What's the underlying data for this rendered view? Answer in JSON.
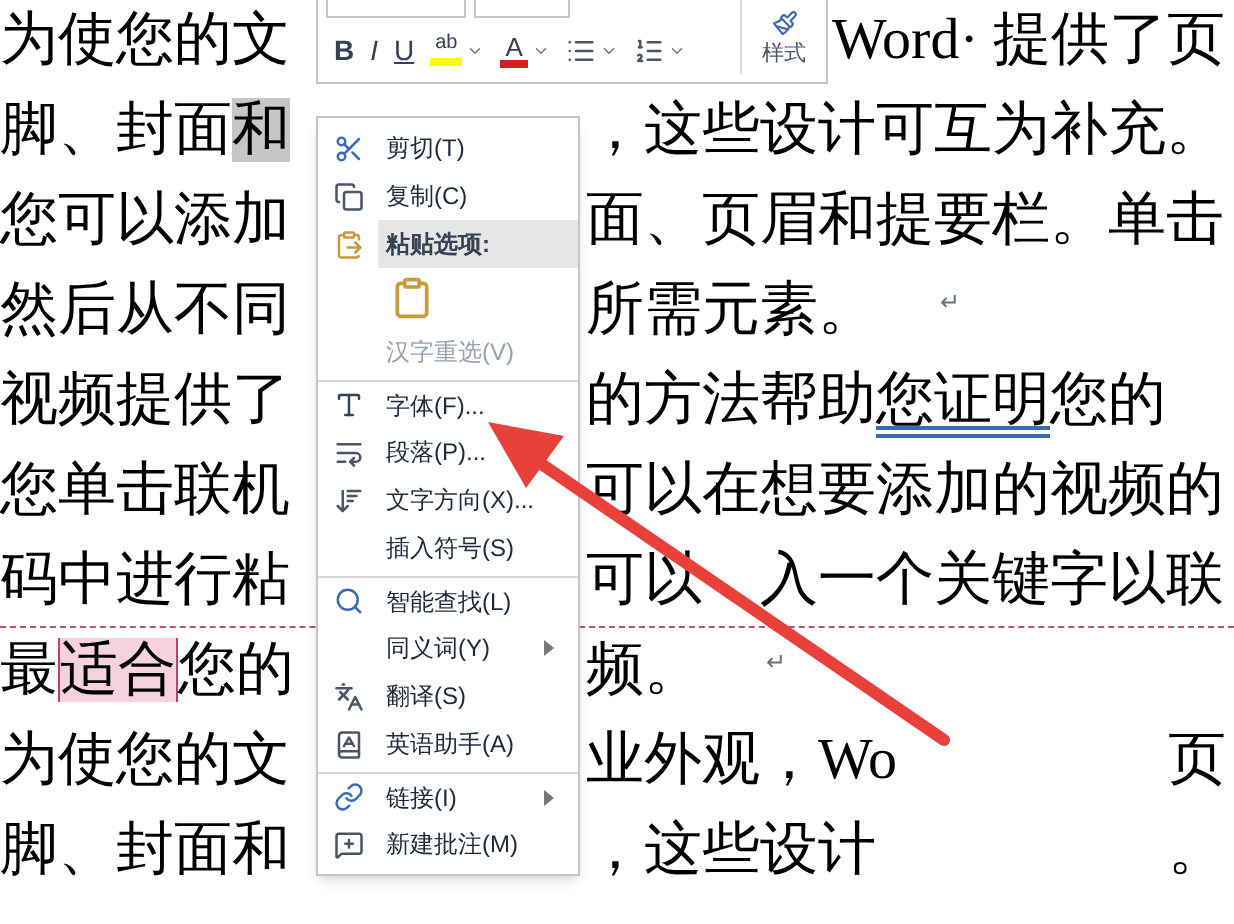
{
  "document": {
    "lines": [
      {
        "kind": "toolbar-row",
        "runs": [
          [
            {
              "kind": "plain",
              "text": "为使您的文"
            }
          ],
          [
            {
              "kind": "plain",
              "text": "Word· 提供了页"
            }
          ]
        ]
      },
      {
        "kind": "menu-row",
        "runs": [
          [
            {
              "kind": "plain",
              "text": "脚、封面"
            },
            {
              "kind": "selection",
              "text": "和"
            }
          ],
          [
            {
              "kind": "plain",
              "text": "，这些设计可互为补充。"
            }
          ]
        ]
      },
      {
        "kind": "menu-row",
        "runs": [
          [
            {
              "kind": "plain",
              "text": "您可以添加"
            }
          ],
          [
            {
              "kind": "plain",
              "text": "面、页眉和提要栏。单击"
            }
          ]
        ]
      },
      {
        "kind": "menu-row",
        "end_mark": "↵",
        "runs": [
          [
            {
              "kind": "plain",
              "text": "然后从不同"
            }
          ],
          [
            {
              "kind": "plain",
              "text": "所需元素。"
            }
          ]
        ]
      },
      {
        "kind": "menu-row",
        "runs": [
          [
            {
              "kind": "plain",
              "text": "视频提供了"
            }
          ],
          [
            {
              "kind": "plain",
              "text": "的方法帮助"
            },
            {
              "kind": "underline",
              "text": "您证明"
            },
            {
              "kind": "plain",
              "text": "您的"
            }
          ]
        ]
      },
      {
        "kind": "menu-row",
        "runs": [
          [
            {
              "kind": "plain",
              "text": "您单击联机"
            }
          ],
          [
            {
              "kind": "plain",
              "text": "可以在想要添加的视频的"
            }
          ]
        ]
      },
      {
        "kind": "split-row",
        "runs": [
          [
            {
              "kind": "plain",
              "text": "码中进行粘"
            }
          ],
          [
            {
              "kind": "plain",
              "text": "可以"
            }
          ],
          [
            {
              "kind": "plain",
              "text": "入一个关键字以联"
            }
          ]
        ]
      },
      {
        "kind": "menu-row",
        "end_mark": "↵",
        "runs": [
          [
            {
              "kind": "plain",
              "text": "最"
            },
            {
              "kind": "highlight",
              "text": "适合"
            },
            {
              "kind": "plain",
              "text": "您的"
            }
          ],
          [
            {
              "kind": "plain",
              "text": "频。"
            }
          ]
        ]
      },
      {
        "kind": "menu-row",
        "runs": [
          [
            {
              "kind": "plain",
              "text": "为使您的文"
            }
          ],
          [
            {
              "kind": "plain",
              "text": "业外观，Wo"
            }
          ],
          [
            {
              "kind": "plain",
              "text": "页"
            }
          ]
        ]
      },
      {
        "kind": "menu-row",
        "runs": [
          [
            {
              "kind": "plain",
              "text": "脚、封面和"
            }
          ],
          [
            {
              "kind": "plain",
              "text": "，这些设计"
            }
          ],
          [
            {
              "kind": "plain",
              "text": "。"
            }
          ]
        ]
      }
    ]
  },
  "toolbar": {
    "buttons": [
      {
        "kind": "bold",
        "label": "B"
      },
      {
        "kind": "italic",
        "label": "I"
      },
      {
        "kind": "underline",
        "label": "U"
      },
      {
        "kind": "highlight",
        "label": "ab"
      },
      {
        "kind": "font-color",
        "label": "A"
      },
      {
        "kind": "bullets"
      },
      {
        "kind": "numbering"
      }
    ],
    "style_button": "样式"
  },
  "menu": [
    {
      "kind": "command",
      "label": "剪切(T)",
      "disabled": false,
      "submenu": false,
      "separator_before": false
    },
    {
      "kind": "command",
      "label": "复制(C)",
      "disabled": false,
      "submenu": false,
      "separator_before": false
    },
    {
      "kind": "header",
      "label": "粘贴选项:"
    },
    {
      "kind": "paste-options"
    },
    {
      "kind": "command",
      "label": "汉字重选(V)",
      "disabled": true,
      "submenu": false,
      "separator_before": false
    },
    {
      "kind": "command",
      "label": "字体(F)...",
      "disabled": false,
      "submenu": false,
      "separator_before": true
    },
    {
      "kind": "command",
      "label": "段落(P)...",
      "disabled": false,
      "submenu": false,
      "separator_before": false
    },
    {
      "kind": "command",
      "label": "文字方向(X)...",
      "disabled": false,
      "submenu": false,
      "separator_before": false
    },
    {
      "kind": "command",
      "label": "插入符号(S)",
      "disabled": false,
      "submenu": false,
      "separator_before": false
    },
    {
      "kind": "command",
      "label": "智能查找(L)",
      "disabled": false,
      "submenu": false,
      "separator_before": true
    },
    {
      "kind": "command",
      "label": "同义词(Y)",
      "disabled": false,
      "submenu": true,
      "separator_before": false
    },
    {
      "kind": "command",
      "label": "翻译(S)",
      "disabled": false,
      "submenu": false,
      "separator_before": false
    },
    {
      "kind": "command",
      "label": "英语助手(A)",
      "disabled": false,
      "submenu": false,
      "separator_before": false
    },
    {
      "kind": "command",
      "label": "链接(I)",
      "disabled": false,
      "submenu": true,
      "separator_before": true
    },
    {
      "kind": "command",
      "label": "新建批注(M)",
      "disabled": false,
      "submenu": false,
      "separator_before": false
    }
  ]
}
